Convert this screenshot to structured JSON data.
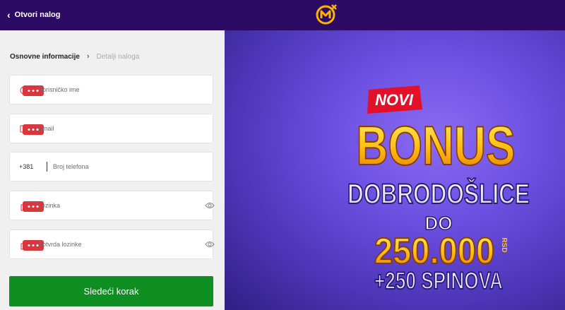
{
  "header": {
    "back_label": "Otvori nalog",
    "back_icon": "chevron-left-icon",
    "logo_icon": "mozzart-logo-icon"
  },
  "steps": {
    "current": "Osnovne informacije",
    "next": "Detalji naloga"
  },
  "form": {
    "username_placeholder": "Korisničko ime",
    "email_placeholder": "Email",
    "phone_prefix": "+381",
    "phone_placeholder": "Broj telefona",
    "password_placeholder": "Lozinka",
    "password_confirm_placeholder": "Potvrda lozinke",
    "submit_label": "Sledeći korak"
  },
  "banner": {
    "tag": "NOVI",
    "headline": "BONUS",
    "subheadline": "DOBRODOŠLICE",
    "upto": "DO",
    "amount": "250.000",
    "currency": "RSD",
    "spins": "+250 SPINOVA"
  },
  "colors": {
    "header_bg": "#2d0a63",
    "button_green": "#0f8e21",
    "banner_purple": "#6b4fe0",
    "accent_yellow": "#ffc21a",
    "tag_red": "#e3102a"
  }
}
